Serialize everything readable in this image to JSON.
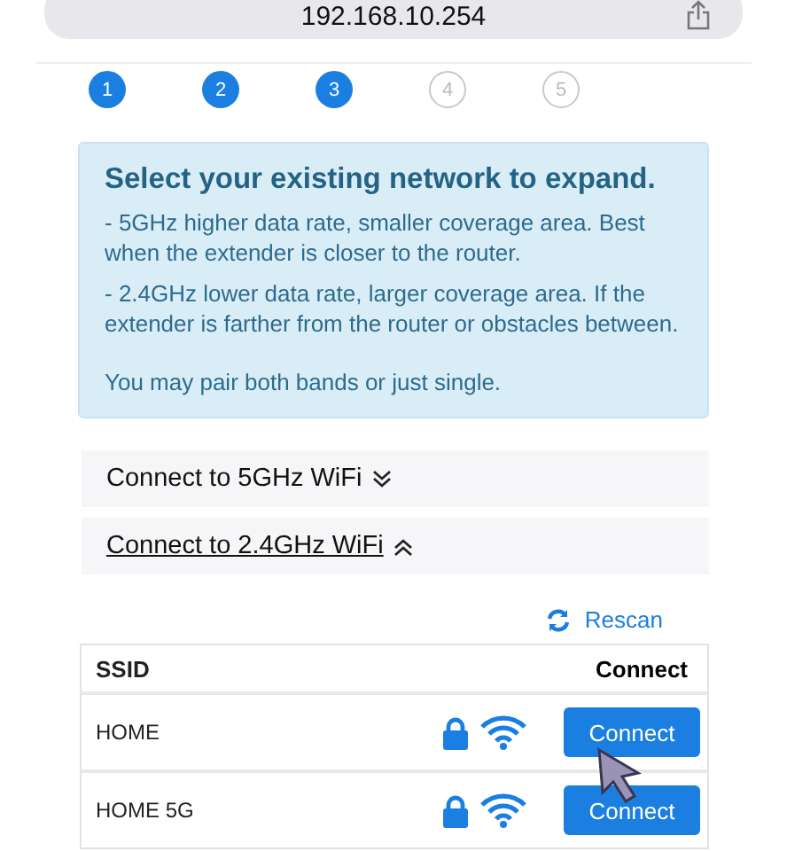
{
  "address_bar": {
    "url": "192.168.10.254"
  },
  "steps": [
    {
      "label": "1",
      "done": true
    },
    {
      "label": "2",
      "done": true
    },
    {
      "label": "3",
      "done": true
    },
    {
      "label": "4",
      "done": false
    },
    {
      "label": "5",
      "done": false
    }
  ],
  "info": {
    "title": "Select your existing network to expand.",
    "lines": [
      "- 5GHz higher data rate, smaller coverage area. Best when the extender is closer to the router.",
      "- 2.4GHz lower data rate, larger coverage area. If the extender is farther from the router or obstacles between."
    ],
    "note": "You may pair both bands or just single."
  },
  "sections": [
    {
      "label": "Connect to 5GHz WiFi",
      "expanded": false
    },
    {
      "label": "Connect to 2.4GHz WiFi",
      "expanded": true
    }
  ],
  "rescan": "Rescan",
  "table": {
    "columns": [
      "SSID",
      "Connect"
    ],
    "rows": [
      {
        "ssid": "HOME",
        "secured": true,
        "button": "Connect"
      },
      {
        "ssid": "HOME 5G",
        "secured": true,
        "button": "Connect"
      }
    ]
  }
}
